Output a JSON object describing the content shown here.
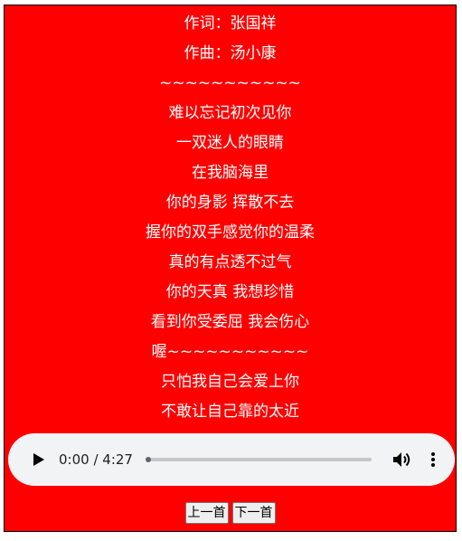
{
  "lyrics": [
    "作词：张国祥",
    "作曲：汤小康",
    "~~~~~~~~~~~",
    "难以忘记初次见你",
    "一双迷人的眼睛",
    "在我脑海里",
    "你的身影 挥散不去",
    "握你的双手感觉你的温柔",
    "真的有点透不过气",
    "你的天真 我想珍惜",
    "看到你受委屈 我会伤心",
    "喔~~~~~~~~~~~",
    "只怕我自己会爱上你",
    "不敢让自己靠的太近"
  ],
  "player": {
    "time": "0:00 / 4:27",
    "progress": 0
  },
  "buttons": {
    "prev_label": "上一首",
    "next_label": "下一首"
  },
  "colors": {
    "background": "#ff0000",
    "text": "#ffffff",
    "player_bg": "#f1f3f4"
  }
}
